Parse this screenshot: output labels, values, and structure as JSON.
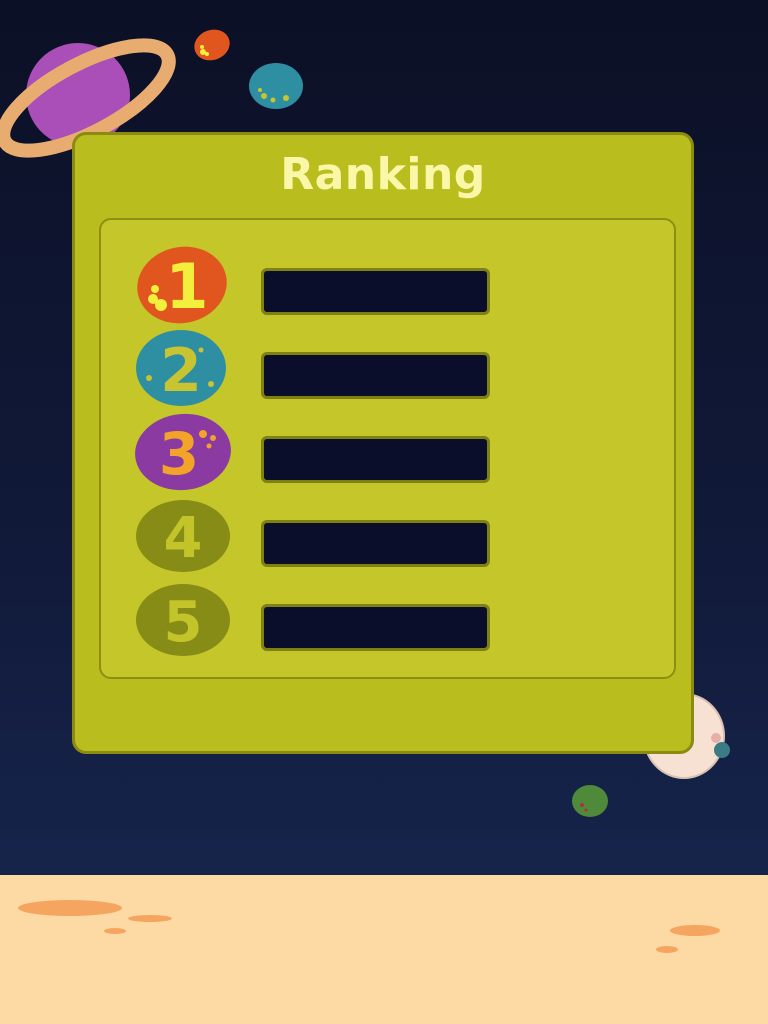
{
  "title": "Ranking",
  "ranks": [
    {
      "label": "1",
      "badge_color": "#e0561e",
      "digit_color": "#f3ef3d"
    },
    {
      "label": "2",
      "badge_color": "#2e8fa3",
      "digit_color": "#c8c431"
    },
    {
      "label": "3",
      "badge_color": "#8a3aa0",
      "digit_color": "#f1a32a"
    },
    {
      "label": "4",
      "badge_color": "#868c16",
      "digit_color": "#c2c42a"
    },
    {
      "label": "5",
      "badge_color": "#868c16",
      "digit_color": "#c2c42a"
    }
  ],
  "colors": {
    "space": "#0c1026",
    "panel": "#b9bd1e",
    "panel_border": "#8b8a12",
    "slot": "#0b0e2a",
    "ground": "#fddaa4",
    "title": "#fbf7a9"
  }
}
